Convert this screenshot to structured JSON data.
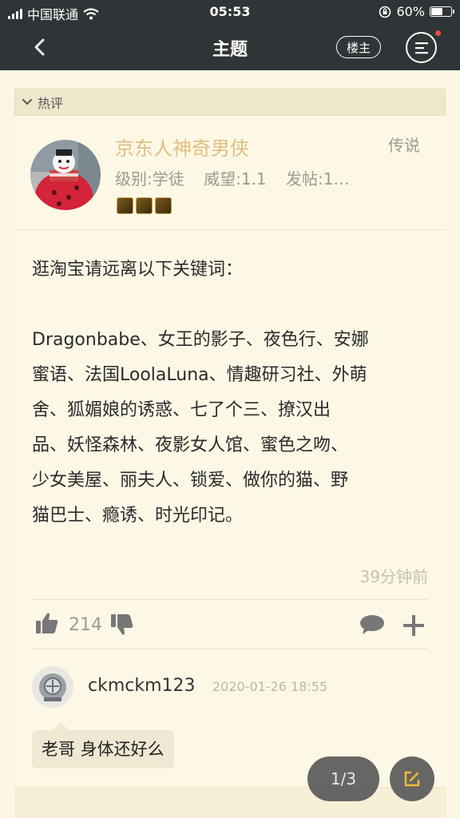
{
  "status_bar": {
    "carrier": "中国联通",
    "time": "05:53",
    "battery": "60%",
    "battery_level": 0.6
  },
  "nav": {
    "title": "主题",
    "owner_label": "楼主"
  },
  "section": {
    "label": "热评"
  },
  "post": {
    "username": "京东人神奇男侠",
    "rank": "传说",
    "level": "级别:学徒",
    "reputation": "威望:1.1",
    "posts": "发帖:1…",
    "content": [
      "逛淘宝请远离以下关键词：",
      "",
      "Dragonbabe、女王的影子、夜色行、安娜",
      "蜜语、法国LoolaLuna、情趣研习社、外萌",
      "舍、狐媚娘的诱惑、七了个三、撩汉出",
      "品、妖怪森林、夜影女人馆、蜜色之吻、",
      "少女美屋、丽夫人、锁爱、做你的猫、野",
      "猫巴士、瘾诱、时光印记。"
    ],
    "time_ago": "39分钟前",
    "likes": "214"
  },
  "reply": {
    "username": "ckmckm123",
    "date": "2020-01-26 18:55",
    "text": "老哥 身体还好么"
  },
  "pager": {
    "label": "1/3"
  },
  "icons": {
    "back": "chevron-left-icon",
    "menu": "menu-icon",
    "like": "thumbs-up-icon",
    "dislike": "thumbs-down-icon",
    "comment": "comment-icon",
    "add": "plus-icon",
    "edit": "edit-icon"
  },
  "colors": {
    "nav_bg": "#2f3437",
    "page_bg": "#fdf6e3",
    "username": "#e1bf80",
    "notification_dot": "#e94a4a"
  }
}
